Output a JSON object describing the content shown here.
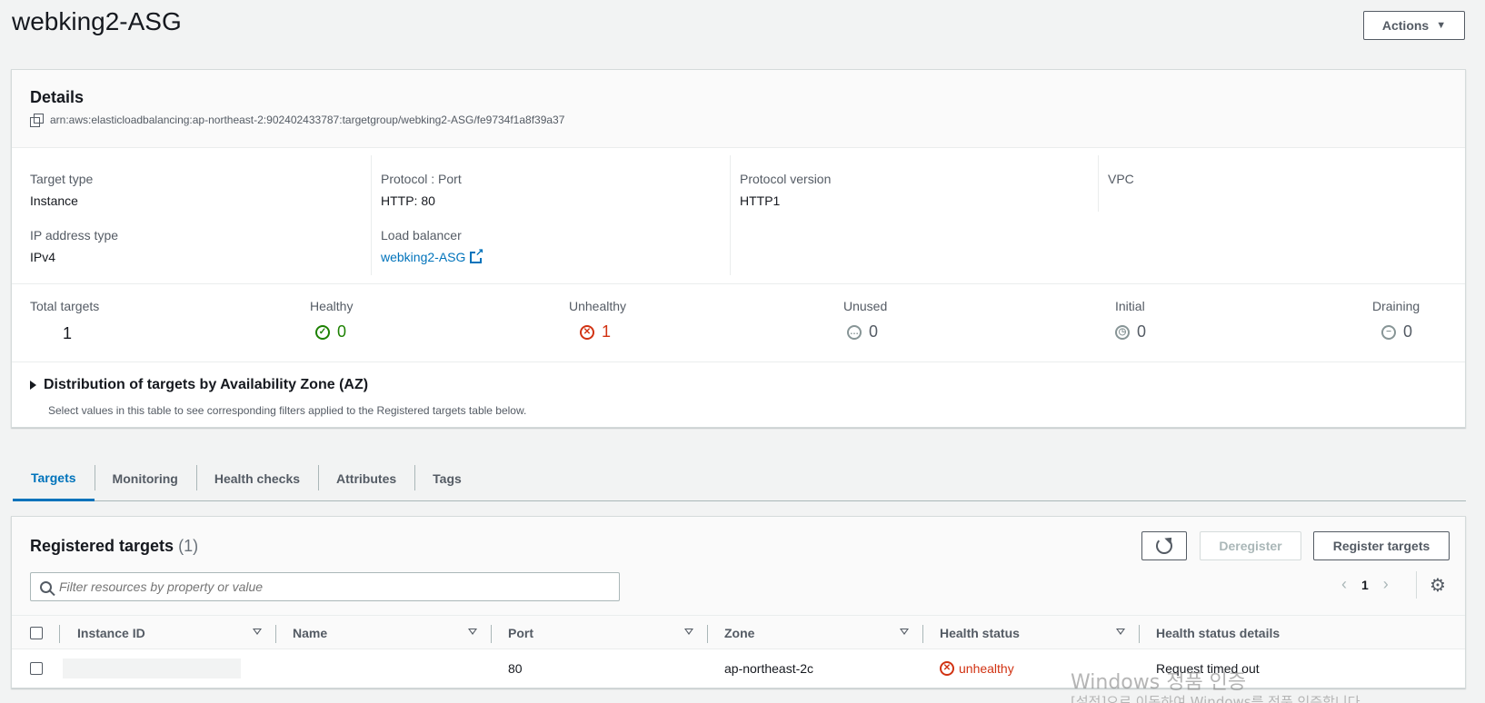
{
  "header": {
    "title": "webking2-ASG",
    "actions_label": "Actions"
  },
  "details": {
    "title": "Details",
    "arn": "arn:aws:elasticloadbalancing:ap-northeast-2:902402433787:targetgroup/webking2-ASG/fe9734f1a8f39a37",
    "target_type_label": "Target type",
    "target_type_value": "Instance",
    "ip_type_label": "IP address type",
    "ip_type_value": "IPv4",
    "protocol_port_label": "Protocol : Port",
    "protocol_port_value": "HTTP: 80",
    "load_balancer_label": "Load balancer",
    "load_balancer_value": "webking2-ASG",
    "protocol_version_label": "Protocol version",
    "protocol_version_value": "HTTP1",
    "vpc_label": "VPC"
  },
  "counts": {
    "total_label": "Total targets",
    "total_value": "1",
    "healthy_label": "Healthy",
    "healthy_value": "0",
    "unhealthy_label": "Unhealthy",
    "unhealthy_value": "1",
    "unused_label": "Unused",
    "unused_value": "0",
    "initial_label": "Initial",
    "initial_value": "0",
    "draining_label": "Draining",
    "draining_value": "0"
  },
  "az": {
    "title": "Distribution of targets by Availability Zone (AZ)",
    "description": "Select values in this table to see corresponding filters applied to the Registered targets table below."
  },
  "tabs": [
    "Targets",
    "Monitoring",
    "Health checks",
    "Attributes",
    "Tags"
  ],
  "registered": {
    "title": "Registered targets",
    "count": "(1)",
    "deregister_label": "Deregister",
    "register_label": "Register targets",
    "search_placeholder": "Filter resources by property or value",
    "page": "1",
    "columns": [
      "Instance ID",
      "Name",
      "Port",
      "Zone",
      "Health status",
      "Health status details"
    ],
    "rows": [
      {
        "instance_id": "",
        "name": "",
        "port": "80",
        "zone": "ap-northeast-2c",
        "health": "unhealthy",
        "details": "Request timed out"
      }
    ]
  },
  "watermark": {
    "line1": "Windows 정품 인증",
    "line2": "[설정]으로 이동하여 Windows를 정품 인증합니다."
  },
  "colors": {
    "link": "#0073bb",
    "healthy": "#1d8102",
    "unhealthy": "#d13212"
  }
}
